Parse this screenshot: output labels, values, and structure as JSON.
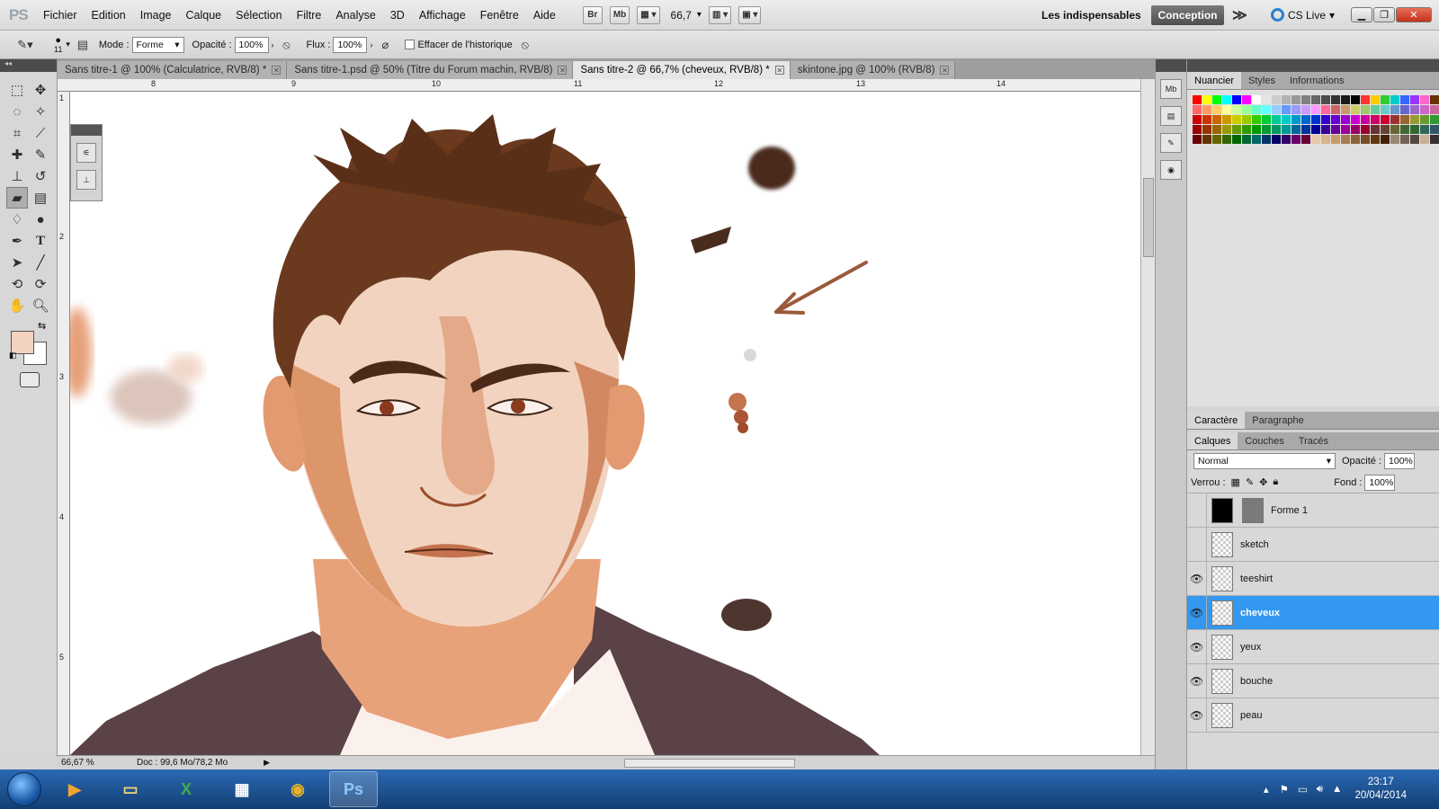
{
  "menubar": {
    "logo": "PS",
    "items": [
      "Fichier",
      "Edition",
      "Image",
      "Calque",
      "Sélection",
      "Filtre",
      "Analyse",
      "3D",
      "Affichage",
      "Fenêtre",
      "Aide"
    ],
    "bridge": "Br",
    "minibridge": "Mb",
    "zoom": "66,7",
    "workspace_label": "Les indispensables",
    "workspace_active": "Conception",
    "more": "≫",
    "cslive": "CS Live"
  },
  "options": {
    "brush_size": "11",
    "mode_label": "Mode :",
    "mode_value": "Forme",
    "opacity_label": "Opacité :",
    "opacity_value": "100%",
    "flow_label": "Flux :",
    "flow_value": "100%",
    "history_label": "Effacer de l'historique"
  },
  "doc_tabs": [
    {
      "label": "Sans titre-1 @ 100% (Calculatrice, RVB/8) *"
    },
    {
      "label": "Sans titre-1.psd @ 50% (Titre du Forum machin, RVB/8)"
    },
    {
      "label": "Sans titre-2 @ 66,7% (cheveux, RVB/8) *"
    },
    {
      "label": "skintone.jpg @ 100% (RVB/8)"
    }
  ],
  "ruler_h": [
    "8",
    "9",
    "10",
    "11",
    "12",
    "13",
    "14"
  ],
  "ruler_v": [
    "1",
    "2",
    "3",
    "4",
    "5"
  ],
  "status": {
    "zoom": "66,67 %",
    "doc": "Doc : 99,6 Mo/78,2 Mo"
  },
  "panels": {
    "swatch_tabs": [
      "Nuancier",
      "Styles",
      "Informations"
    ],
    "char_tabs": [
      "Caractère",
      "Paragraphe"
    ],
    "layer_tabs": [
      "Calques",
      "Couches",
      "Tracés"
    ],
    "blend": "Normal",
    "opacity_label": "Opacité :",
    "opacity_value": "100%",
    "lock_label": "Verrou :",
    "fill_label": "Fond :",
    "fill_value": "100%",
    "layers": [
      {
        "name": "Forme 1",
        "visible": false,
        "selected": false
      },
      {
        "name": "sketch",
        "visible": false,
        "selected": false
      },
      {
        "name": "teeshirt",
        "visible": true,
        "selected": false
      },
      {
        "name": "cheveux",
        "visible": true,
        "selected": true
      },
      {
        "name": "yeux",
        "visible": true,
        "selected": false
      },
      {
        "name": "bouche",
        "visible": true,
        "selected": false
      },
      {
        "name": "peau",
        "visible": true,
        "selected": false
      }
    ]
  },
  "swatches": {
    "row1": [
      "#ff0000",
      "#ffff00",
      "#00ff00",
      "#00ffff",
      "#0000ff",
      "#ff00ff",
      "#ffffff",
      "#e6e6e6",
      "#cccccc",
      "#b3b3b3",
      "#999999",
      "#808080",
      "#666666",
      "#4d4d4d",
      "#333333",
      "#1a1a1a",
      "#000000",
      "#ff3333",
      "#ffcc00",
      "#33cc33",
      "#00cccc",
      "#3366ff",
      "#9933ff",
      "#ff66cc",
      "#663300"
    ],
    "row2": [
      "#ff6666",
      "#ff9966",
      "#ffcc66",
      "#ffff99",
      "#ccff99",
      "#99ff99",
      "#66ffcc",
      "#66ffff",
      "#99ccff",
      "#6699ff",
      "#9999ff",
      "#cc99ff",
      "#ff99ff",
      "#ff6699",
      "#cc6666",
      "#cc9966",
      "#cccc66",
      "#99cc66",
      "#66cc99",
      "#66cccc",
      "#6699cc",
      "#6666cc",
      "#9966cc",
      "#cc66cc",
      "#cc6699"
    ],
    "row3": [
      "#cc0000",
      "#cc3300",
      "#cc6600",
      "#cc9900",
      "#cccc00",
      "#99cc00",
      "#33cc00",
      "#00cc33",
      "#00cc99",
      "#00cccc",
      "#0099cc",
      "#0066cc",
      "#0033cc",
      "#3300cc",
      "#6600cc",
      "#9900cc",
      "#cc00cc",
      "#cc0099",
      "#cc0066",
      "#cc0033",
      "#993333",
      "#996633",
      "#999933",
      "#669933",
      "#339933"
    ],
    "row4": [
      "#990000",
      "#993300",
      "#996600",
      "#999900",
      "#669900",
      "#339900",
      "#009900",
      "#009933",
      "#009966",
      "#009999",
      "#006699",
      "#003399",
      "#000099",
      "#330099",
      "#660099",
      "#990099",
      "#990066",
      "#990033",
      "#663333",
      "#664433",
      "#666633",
      "#446633",
      "#336633",
      "#336655",
      "#335566"
    ],
    "row5": [
      "#660000",
      "#663300",
      "#666600",
      "#336600",
      "#006600",
      "#006633",
      "#006666",
      "#003366",
      "#000066",
      "#330066",
      "#660066",
      "#660033",
      "#e8c9a8",
      "#d9b38c",
      "#c69c6d",
      "#a67c52",
      "#8c6239",
      "#754c24",
      "#603913",
      "#42210b",
      "#998675",
      "#736357",
      "#534741",
      "#c7b299",
      "#362f2d"
    ]
  },
  "taskbar": {
    "apps": [
      "media",
      "explorer",
      "excel",
      "apps",
      "chrome",
      "Ps"
    ],
    "time": "23:17",
    "date": "20/04/2014"
  }
}
